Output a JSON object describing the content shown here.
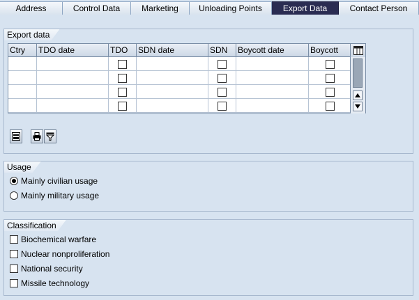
{
  "tabs": [
    {
      "label": "Address",
      "active": false
    },
    {
      "label": "Control Data",
      "active": false
    },
    {
      "label": "Marketing",
      "active": false
    },
    {
      "label": "Unloading Points",
      "active": false
    },
    {
      "label": "Export Data",
      "active": true
    },
    {
      "label": "Contact Person",
      "active": false
    }
  ],
  "export_group": {
    "title": "Export data",
    "columns": [
      "Ctry",
      "TDO date",
      "TDO",
      "SDN date",
      "SDN",
      "Boycott date",
      "Boycott"
    ],
    "rows": [
      {
        "ctry": "",
        "tdo_date": "",
        "tdo": false,
        "sdn_date": "",
        "sdn": false,
        "boycott_date": "",
        "boycott": false
      },
      {
        "ctry": "",
        "tdo_date": "",
        "tdo": false,
        "sdn_date": "",
        "sdn": false,
        "boycott_date": "",
        "boycott": false
      },
      {
        "ctry": "",
        "tdo_date": "",
        "tdo": false,
        "sdn_date": "",
        "sdn": false,
        "boycott_date": "",
        "boycott": false
      },
      {
        "ctry": "",
        "tdo_date": "",
        "tdo": false,
        "sdn_date": "",
        "sdn": false,
        "boycott_date": "",
        "boycott": false
      }
    ]
  },
  "usage_group": {
    "title": "Usage",
    "options": [
      {
        "label": "Mainly civilian usage",
        "selected": true
      },
      {
        "label": "Mainly military usage",
        "selected": false
      }
    ]
  },
  "classification_group": {
    "title": "Classification",
    "options": [
      {
        "label": "Biochemical warfare",
        "checked": false
      },
      {
        "label": "Nuclear nonproliferation",
        "checked": false
      },
      {
        "label": "National security",
        "checked": false
      },
      {
        "label": "Missile technology",
        "checked": false
      }
    ]
  },
  "colors": {
    "background": "#d7e3f0",
    "active_tab": "#2a2c52",
    "border": "#6f8fb4"
  }
}
